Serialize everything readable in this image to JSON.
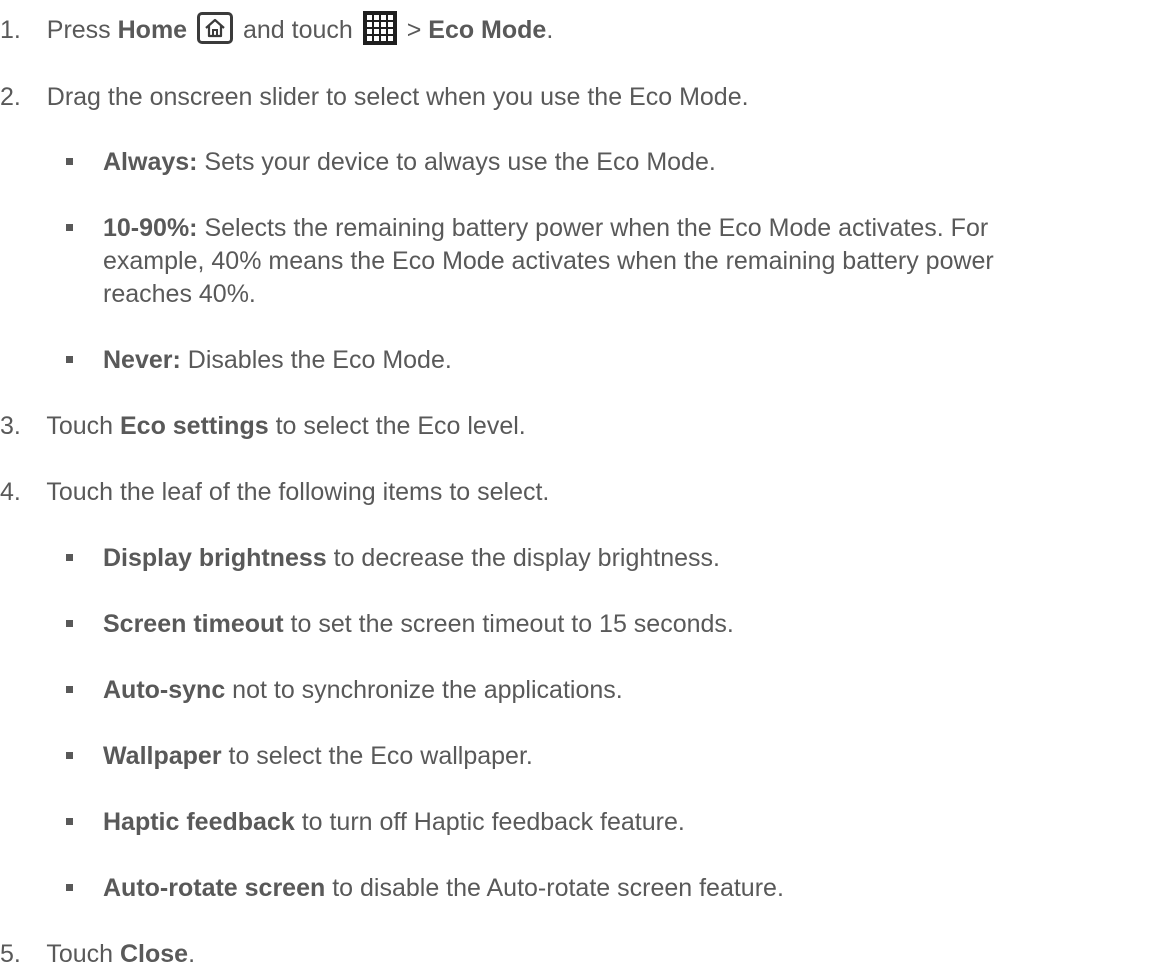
{
  "steps": [
    {
      "num": "1.",
      "press": "Press ",
      "home_label": "Home",
      "and_touch": " and touch ",
      "gt": " > ",
      "eco_mode": "Eco Mode",
      "period": ".",
      "home_icon": "home-icon",
      "apps_icon": "apps-grid-icon"
    },
    {
      "num": "2.",
      "text": "Drag the onscreen slider to select when you use the Eco Mode.",
      "bullets": [
        {
          "label": "Always:",
          "text": " Sets your device to always use the Eco Mode."
        },
        {
          "label": "10-90%:",
          "text": " Selects the remaining battery power when the Eco Mode activates. For",
          "line2": "example, 40% means the Eco Mode activates when the remaining battery power",
          "line3": "reaches 40%."
        },
        {
          "label": "Never:",
          "text": " Disables the Eco Mode."
        }
      ]
    },
    {
      "num": "3.",
      "pre": "Touch ",
      "bold": "Eco settings",
      "post": " to select the Eco level."
    },
    {
      "num": "4.",
      "text": "Touch the leaf of the following items to select.",
      "bullets": [
        {
          "label": "Display brightness",
          "text": " to decrease the display brightness."
        },
        {
          "label": "Screen timeout",
          "text": " to set the screen timeout to 15 seconds."
        },
        {
          "label": "Auto-sync",
          "text": " not to synchronize the applications."
        },
        {
          "label": "Wallpaper",
          "text": " to select the Eco wallpaper."
        },
        {
          "label": "Haptic feedback",
          "text": " to turn off Haptic feedback feature."
        },
        {
          "label": "Auto-rotate screen",
          "text": " to disable the Auto-rotate screen feature."
        }
      ]
    },
    {
      "num": "5.",
      "pre": "Touch ",
      "bold": "Close",
      "post": "."
    }
  ]
}
